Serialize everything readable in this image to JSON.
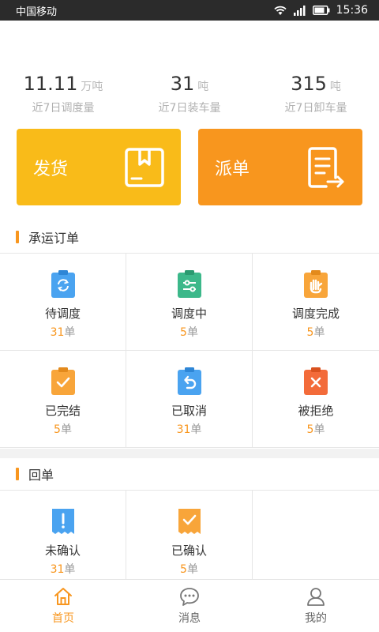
{
  "status_bar": {
    "carrier": "中国移动",
    "time": "15:36"
  },
  "stats": [
    {
      "value": "11.11",
      "unit": "万吨",
      "label": "近7日调度量"
    },
    {
      "value": "31",
      "unit": "吨",
      "label": "近7日装车量"
    },
    {
      "value": "315",
      "unit": "吨",
      "label": "近7日卸车量"
    }
  ],
  "actions": {
    "ship": {
      "label": "发货",
      "color": "#f9bb19",
      "icon": "box-icon"
    },
    "dispatch": {
      "label": "派单",
      "color": "#f8961e",
      "icon": "document-arrow-icon"
    }
  },
  "order_section": {
    "title": "承运订单",
    "items": [
      {
        "label": "待调度",
        "count": "31",
        "unit": "单",
        "icon": "clipboard-refresh-icon",
        "color": "#4aa3f0"
      },
      {
        "label": "调度中",
        "count": "5",
        "unit": "单",
        "icon": "clipboard-sliders-icon",
        "color": "#3cb88a"
      },
      {
        "label": "调度完成",
        "count": "5",
        "unit": "单",
        "icon": "clipboard-hand-icon",
        "color": "#f8a53a"
      },
      {
        "label": "已完结",
        "count": "5",
        "unit": "单",
        "icon": "clipboard-check-icon",
        "color": "#f8a53a"
      },
      {
        "label": "已取消",
        "count": "31",
        "unit": "单",
        "icon": "clipboard-undo-icon",
        "color": "#4aa3f0"
      },
      {
        "label": "被拒绝",
        "count": "5",
        "unit": "单",
        "icon": "clipboard-x-icon",
        "color": "#f36b3a"
      }
    ]
  },
  "receipt_section": {
    "title": "回单",
    "items": [
      {
        "label": "未确认",
        "count": "31",
        "unit": "单",
        "icon": "receipt-exclamation-icon",
        "color": "#4aa3f0"
      },
      {
        "label": "已确认",
        "count": "5",
        "unit": "单",
        "icon": "receipt-check-icon",
        "color": "#f8a53a"
      }
    ]
  },
  "bottom_nav": [
    {
      "label": "首页",
      "icon": "home-icon",
      "active": true
    },
    {
      "label": "消息",
      "icon": "chat-bubble-icon",
      "active": false
    },
    {
      "label": "我的",
      "icon": "user-icon",
      "active": false
    }
  ],
  "colors": {
    "accent": "#f8961e",
    "yellow": "#f9bb19"
  }
}
